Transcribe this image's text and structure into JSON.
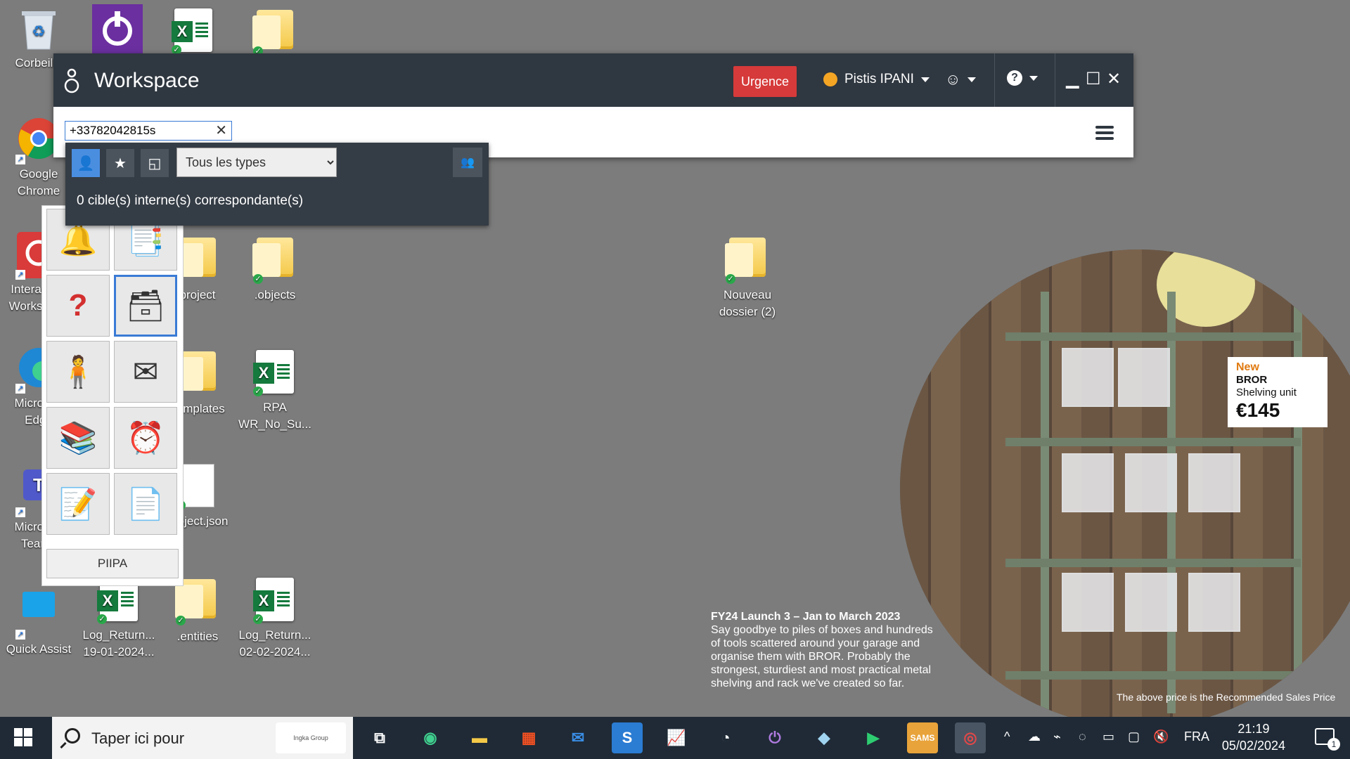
{
  "desktop": {
    "icons": [
      {
        "label": "Corbeille",
        "type": "recycle"
      },
      {
        "label": "",
        "type": "app-purple"
      },
      {
        "label": "",
        "type": "excel"
      },
      {
        "label": "",
        "type": "folder"
      },
      {
        "label": "Google Chrome",
        "type": "chrome"
      },
      {
        "label": "Interaction Workspace",
        "type": "app-red"
      },
      {
        "label": "Microsoft Edge",
        "type": "edge"
      },
      {
        "label": "Microsoft Teams",
        "type": "teams"
      },
      {
        "label": "Quick Assist",
        "type": "quickassist"
      },
      {
        "label": "project",
        "type": "folder"
      },
      {
        "label": ".objects",
        "type": "folder"
      },
      {
        "label": "Templates",
        "type": "folder"
      },
      {
        "label": "RPA WR_No_Su...",
        "type": "excel"
      },
      {
        "label": "project.json",
        "type": "file"
      },
      {
        "label": "Log_Return... 19-01-2024...",
        "type": "excel"
      },
      {
        "label": ".entities",
        "type": "folder"
      },
      {
        "label": "Log_Return... 02-02-2024...",
        "type": "excel"
      },
      {
        "label": "Nouveau dossier (2)",
        "type": "folder"
      }
    ]
  },
  "wallpaper": {
    "price_card": {
      "new": "New",
      "name": "BROR",
      "desc": "Shelving unit",
      "price": "€145"
    },
    "headline": "FY24 Launch 3 – Jan to March 2023",
    "body": "Say goodbye to piles of boxes and hundreds of tools scattered around your garage and organise them with BROR. Probably the strongest, sturdiest and most practical metal shelving and rack we've created so far.",
    "footnote": "The above price is the Recommended Sales Price"
  },
  "workspace": {
    "title": "Workspace",
    "urgence": "Urgence",
    "user": "Pistis IPANI",
    "search_value": "+33782042815s",
    "accent": "#3a7bd5",
    "urgent_color": "#d63a3a"
  },
  "search_dropdown": {
    "type_selected": "Tous les types",
    "result_message": "0 cible(s) interne(s) correspondante(s)"
  },
  "tool_panel": {
    "footer_label": "PIIPA"
  },
  "taskbar": {
    "search_placeholder": "Taper ici pour",
    "search_logo": "Ingka Group",
    "lang": "FRA",
    "time": "21:19",
    "date": "05/02/2024",
    "notif_count": "1",
    "apps": [
      "task-view",
      "edge",
      "explorer",
      "store",
      "mail",
      "s-app",
      "monitor",
      "clock",
      "purple-app",
      "blue-app",
      "green-play",
      "sams",
      "workspace"
    ]
  }
}
